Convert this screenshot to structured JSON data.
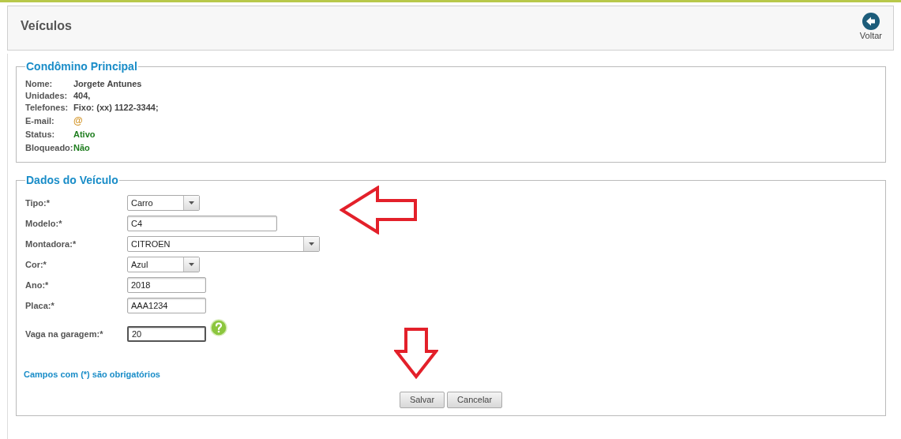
{
  "header": {
    "title": "Veículos",
    "back_button": "Voltar"
  },
  "owner": {
    "legend": "Condômino Principal",
    "rows": [
      {
        "label": "Nome:",
        "value": "Jorgete Antunes"
      },
      {
        "label": "Unidades:",
        "value": "404,"
      },
      {
        "label": "Telefones:",
        "value": "Fixo: (xx) 1122-3344;"
      },
      {
        "label": "E-mail:",
        "value": "@",
        "color": "#d4962a"
      },
      {
        "label": "Status:",
        "value": "Ativo",
        "color": "#1e7d1e"
      },
      {
        "label": "Bloqueado:",
        "value": "Não",
        "color": "#1e7d1e"
      }
    ]
  },
  "vehicle": {
    "legend": "Dados do Veículo",
    "fields": [
      {
        "label": "Tipo:*",
        "kind": "select",
        "value": "Carro"
      },
      {
        "label": "Modelo:*",
        "kind": "text",
        "value": "C4"
      },
      {
        "label": "Montadora:*",
        "kind": "select",
        "value": "CITROEN"
      },
      {
        "label": "Cor:*",
        "kind": "select",
        "value": "Azul"
      },
      {
        "label": "Ano:*",
        "kind": "text",
        "value": "2018"
      },
      {
        "label": "Placa:*",
        "kind": "text",
        "value": "AAA1234"
      },
      {
        "label": "Vaga na garagem:*",
        "kind": "text",
        "value": "20",
        "focused": true,
        "help": true
      }
    ],
    "required_note": "Campos com (*) são obrigatórios",
    "buttons": [
      "Salvar",
      "Cancelar"
    ]
  }
}
